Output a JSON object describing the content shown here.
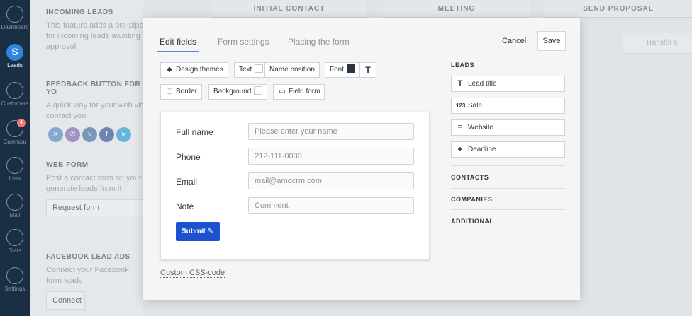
{
  "sidebar": {
    "items": [
      {
        "label": "Dashboard",
        "icon": "dashboard-icon"
      },
      {
        "label": "Leads",
        "icon": "leads-icon",
        "glyph": "S"
      },
      {
        "label": "Customers",
        "icon": "customers-icon"
      },
      {
        "label": "Calendar",
        "icon": "calendar-icon",
        "badge": "4"
      },
      {
        "label": "Lists",
        "icon": "lists-icon"
      },
      {
        "label": "Mail",
        "icon": "mail-icon"
      },
      {
        "label": "Stats",
        "icon": "stats-icon"
      },
      {
        "label": "Settings",
        "icon": "settings-icon"
      }
    ]
  },
  "background": {
    "incoming_title": "INCOMING LEADS",
    "incoming_text": "This feature adds a pre-pipe for incoming leads awaiting approval",
    "feedback_title": "FEEDBACK BUTTON FOR YO",
    "feedback_text": "A quick way for your web vis contact you",
    "webform_title": "WEB FORM",
    "webform_text": "Post a contact form on your generate leads from it",
    "request_form": "Request form",
    "facebook_title": "FACEBOOK LEAD ADS",
    "facebook_text": "Connect your Facebook form leads",
    "connect": "Connect",
    "pipeline": [
      "INITIAL CONTACT",
      "MEETING",
      "SEND PROPOSAL"
    ],
    "transfer": "Transfer c"
  },
  "modal": {
    "tabs": [
      "Edit fields",
      "Form settings",
      "Placing the form"
    ],
    "cancel": "Cancel",
    "save": "Save",
    "toolbar": {
      "design_themes": "Design themes",
      "text": "Text",
      "name_position": "Name position",
      "font": "Font",
      "font_glyph": "T",
      "border": "Border",
      "background": "Background",
      "field_form": "Field form"
    },
    "form": {
      "fields": [
        {
          "label": "Full name",
          "placeholder": "Please enter your name"
        },
        {
          "label": "Phone",
          "placeholder": "212-111-0000"
        },
        {
          "label": "Email",
          "placeholder": "mail@amocrm.com"
        },
        {
          "label": "Note",
          "placeholder": "Comment"
        }
      ],
      "submit": "Submit"
    },
    "custom_css": "Custom CSS-code",
    "right_panel": {
      "leads_title": "LEADS",
      "leads_fields": [
        {
          "label": "Lead title",
          "glyph": "T"
        },
        {
          "label": "Sale",
          "glyph": "123"
        },
        {
          "label": "Website",
          "glyph": "☰"
        },
        {
          "label": "Deadline",
          "glyph": "✚"
        }
      ],
      "contacts": "CONTACTS",
      "companies": "COMPANIES",
      "additional": "ADDITIONAL"
    }
  },
  "colors": {
    "sidebar": "#1b2f44",
    "accent": "#4a8ae0",
    "submit": "#1a52cf"
  }
}
